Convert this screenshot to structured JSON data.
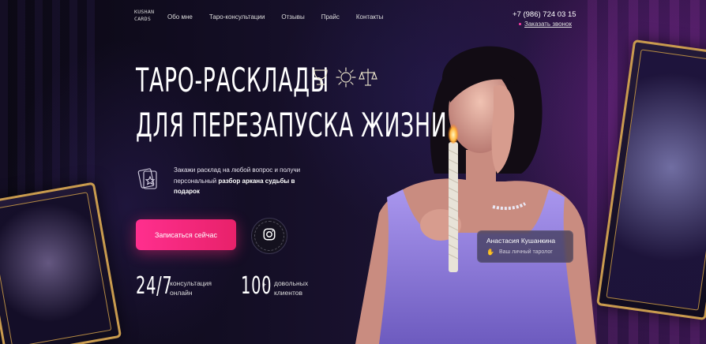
{
  "brand": {
    "logo_line1": "KUSHAN",
    "logo_line2": "CARDS"
  },
  "nav": {
    "items": [
      {
        "label": "Обо мне"
      },
      {
        "label": "Таро-консультации"
      },
      {
        "label": "Отзывы"
      },
      {
        "label": "Прайс"
      },
      {
        "label": "Контакты"
      }
    ]
  },
  "contact": {
    "phone": "+7 (986) 724 03 15",
    "callback_label": "Заказать звонок"
  },
  "hero": {
    "title_line1": "ТАРО-РАСКЛАДЫ",
    "title_line2": "ДЛЯ ПЕРЕЗАПУСКА ЖИЗНИ",
    "symbols": [
      "cup-icon",
      "sun-icon",
      "scales-icon"
    ],
    "desc_plain": "Закажи расклад на любой вопрос и получи персональный ",
    "desc_bold": "разбор аркана судьбы в подарок",
    "cta_label": "Записаться сейчас",
    "instagram_icon": "instagram-icon"
  },
  "stats": [
    {
      "value": "24/7",
      "label": "консультация онлайн"
    },
    {
      "value": "100",
      "suffix": "+",
      "label": "довольных клиентов"
    }
  ],
  "person_badge": {
    "name": "Анастасия Кушанкина",
    "role": "Ваш личный таролог"
  },
  "colors": {
    "accent": "#ff2f8e",
    "gold": "#c99b4e",
    "dress": "#9a86e0"
  }
}
